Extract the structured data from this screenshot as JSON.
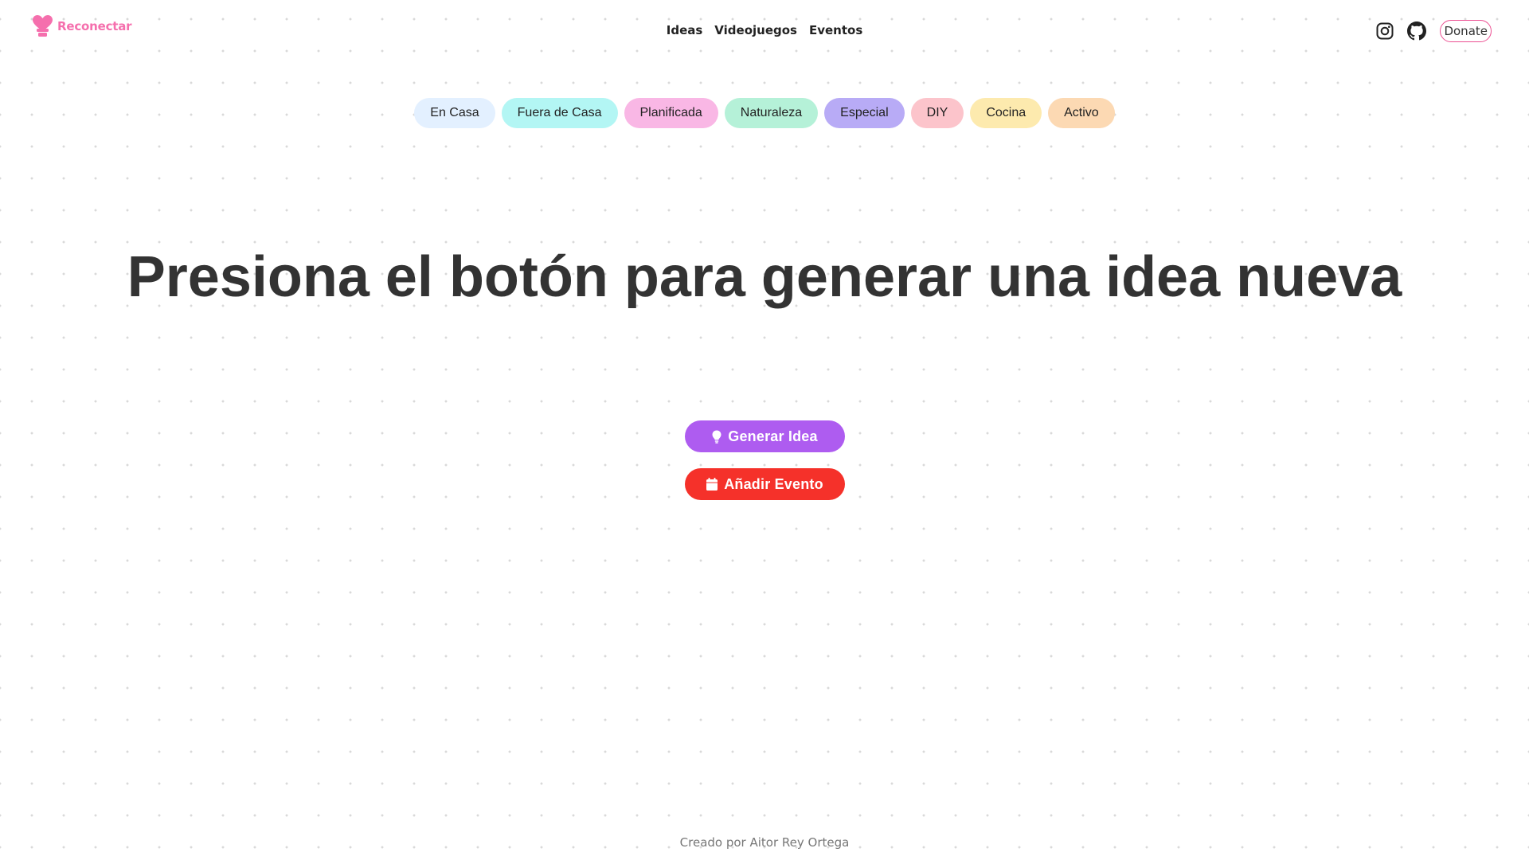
{
  "header": {
    "brand": {
      "name": "Reconectar",
      "icon": "heart-icon",
      "color": "#f56fad"
    },
    "nav": [
      {
        "label": "Ideas"
      },
      {
        "label": "Videojuegos"
      },
      {
        "label": "Eventos"
      }
    ],
    "social": [
      {
        "icon": "instagram-icon"
      },
      {
        "icon": "github-icon"
      }
    ],
    "donate_label": "Donate",
    "donate_border_color": "#ec4f92"
  },
  "categories": [
    {
      "label": "En Casa",
      "color": "#e3f0ff"
    },
    {
      "label": "Fuera de Casa",
      "color": "#b3f6f4"
    },
    {
      "label": "Planificada",
      "color": "#f9b7e5"
    },
    {
      "label": "Naturaleza",
      "color": "#b5f1d8"
    },
    {
      "label": "Especial",
      "color": "#b8abf6"
    },
    {
      "label": "DIY",
      "color": "#fcc4cb"
    },
    {
      "label": "Cocina",
      "color": "#fdeaae"
    },
    {
      "label": "Activo",
      "color": "#fcd9b3"
    }
  ],
  "hero": {
    "title": "Presiona el botón para generar una idea nueva"
  },
  "actions": {
    "generate": {
      "label": "Generar Idea",
      "icon": "lightbulb-icon",
      "color": "#ae5cf0"
    },
    "add_event": {
      "label": "Añadir Evento",
      "icon": "calendar-icon",
      "color": "#f5312a"
    }
  },
  "footer": {
    "credit": "Creado por Aitor Rey Ortega"
  }
}
